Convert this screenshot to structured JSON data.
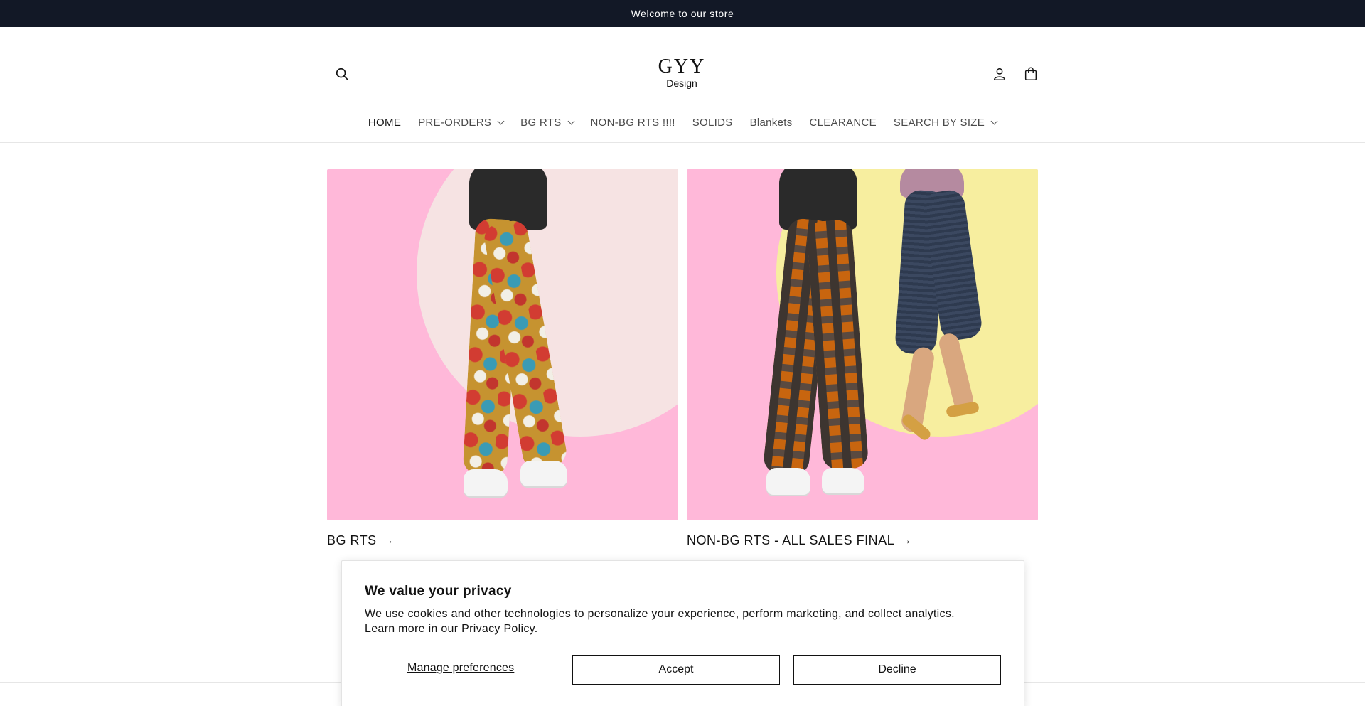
{
  "announcement": {
    "text": "Welcome to our store"
  },
  "header": {
    "logo": {
      "mark": "GYY",
      "sub": "Design"
    },
    "icons": {
      "search": "search-icon",
      "account": "user-icon",
      "cart": "cart-icon"
    }
  },
  "nav": {
    "items": [
      {
        "label": "HOME",
        "active": true,
        "dropdown": false
      },
      {
        "label": "PRE-ORDERS",
        "active": false,
        "dropdown": true
      },
      {
        "label": "BG RTS",
        "active": false,
        "dropdown": true
      },
      {
        "label": "NON-BG RTS !!!!",
        "active": false,
        "dropdown": false
      },
      {
        "label": "SOLIDS",
        "active": false,
        "dropdown": false
      },
      {
        "label": "Blankets",
        "active": false,
        "dropdown": false
      },
      {
        "label": "CLEARANCE",
        "active": false,
        "dropdown": false
      },
      {
        "label": "SEARCH BY SIZE",
        "active": false,
        "dropdown": true
      }
    ]
  },
  "collections": [
    {
      "title": "BG RTS",
      "arrow": "→"
    },
    {
      "title": "NON-BG RTS - ALL SALES FINAL",
      "arrow": "→"
    }
  ],
  "cookie_banner": {
    "title": "We value your privacy",
    "text": "We use cookies and other technologies to personalize your experience, perform marketing, and collect analytics. Learn more in our",
    "link": "Privacy Policy.",
    "manage_label": "Manage preferences",
    "accept_label": "Accept",
    "decline_label": "Decline"
  },
  "colors": {
    "announcement_bg": "#121826",
    "card_bg_pink": "#ffb8d9",
    "circle_light_pink": "#f6e3e3",
    "circle_yellow": "#f7ee9f"
  }
}
